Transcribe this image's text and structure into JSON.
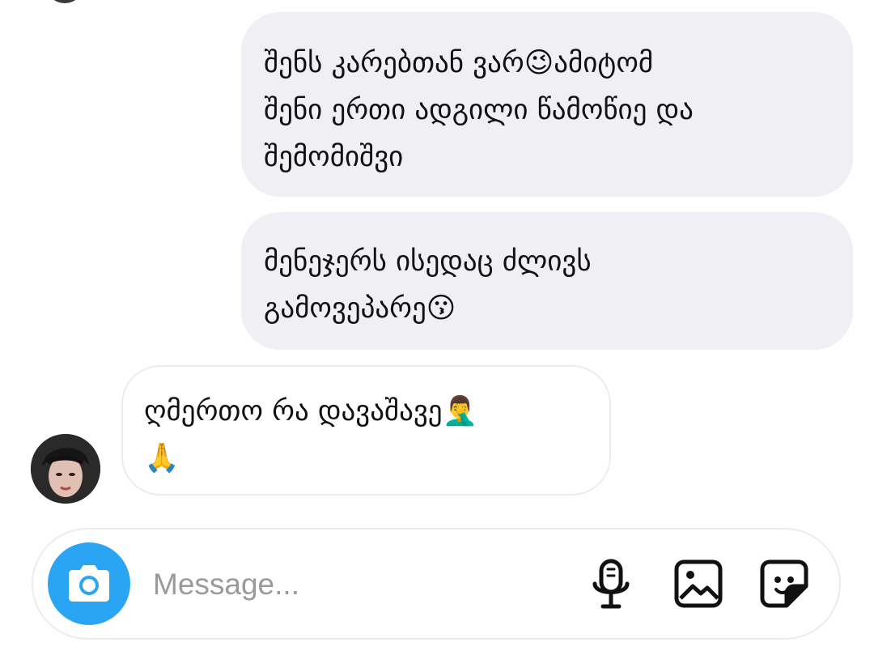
{
  "messages": [
    {
      "direction": "sent",
      "text": "შენს კარებთან ვარ😉ამიტომ\nშენი ერთი ადგილი წამოწიე და\nშემომიშვი"
    },
    {
      "direction": "sent",
      "text": "მენეჯერს ისედაც ძლივს\nგამოვეპარე😗"
    },
    {
      "direction": "received",
      "text": "ღმერთო რა დავაშავე🤦‍♂️\n🙏"
    }
  ],
  "composer": {
    "placeholder": "Message...",
    "value": "",
    "icons": {
      "camera": "camera-icon",
      "mic": "microphone-icon",
      "gallery": "image-gallery-icon",
      "sticker": "sticker-icon"
    }
  },
  "colors": {
    "sent_bubble": "#efeff4",
    "received_border": "#ececec",
    "camera_button": "#2aa5f4",
    "placeholder": "#9a9a9a"
  }
}
